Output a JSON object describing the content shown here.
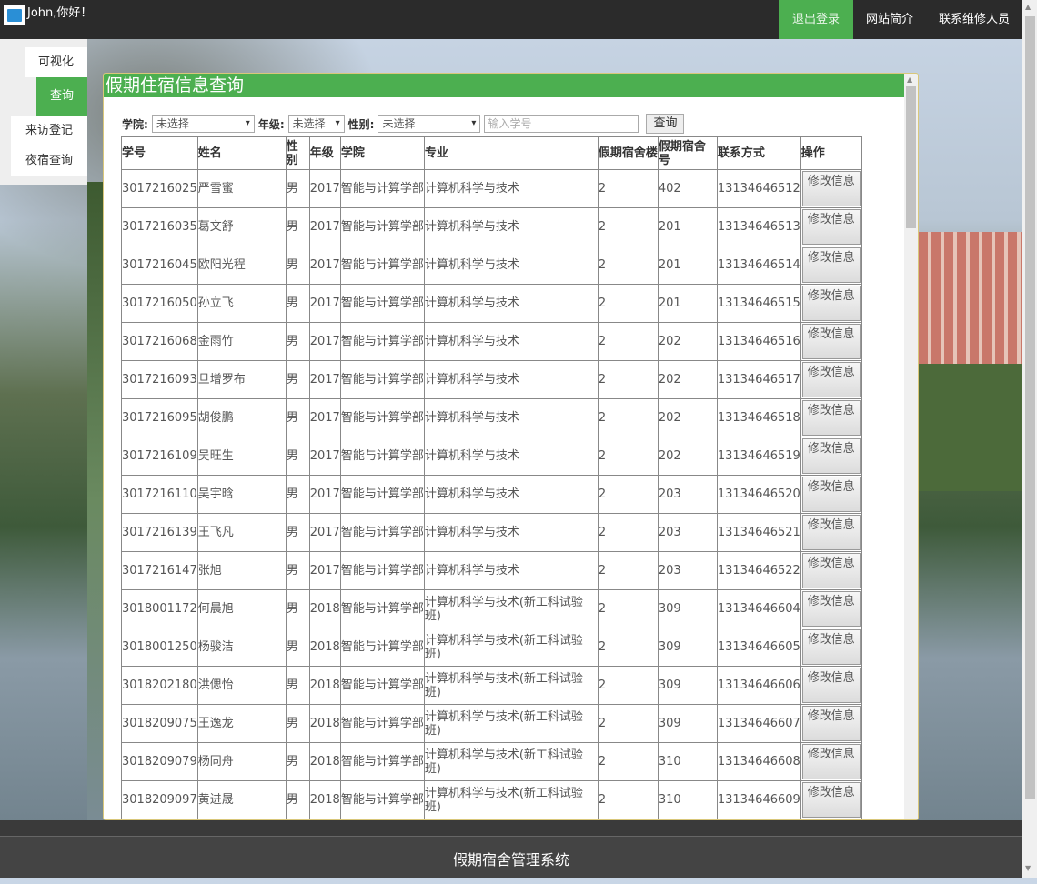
{
  "header": {
    "greeting": "John,你好！",
    "nav": [
      "退出登录",
      "网站简介",
      "联系维修人员"
    ]
  },
  "sidebar": {
    "items": [
      "可视化",
      "查询",
      "来访登记",
      "夜宿查询"
    ]
  },
  "panel": {
    "title": "假期住宿信息查询"
  },
  "filters": {
    "college_label": "学院:",
    "college_value": "未选择",
    "grade_label": "年级:",
    "grade_value": "未选择",
    "gender_label": "性别:",
    "gender_value": "未选择",
    "id_placeholder": "输入学号",
    "query_button": "查询"
  },
  "table": {
    "headers": [
      "学号",
      "姓名",
      "性别",
      "年级",
      "学院",
      "专业",
      "假期宿舍楼",
      "假期宿舍号",
      "联系方式",
      "操作"
    ],
    "edit_label": "修改信息",
    "rows": [
      [
        "3017216025",
        "严雪蜜",
        "男",
        "2017",
        "智能与计算学部",
        "计算机科学与技术",
        "2",
        "402",
        "13134646512"
      ],
      [
        "3017216035",
        "葛文舒",
        "男",
        "2017",
        "智能与计算学部",
        "计算机科学与技术",
        "2",
        "201",
        "13134646513"
      ],
      [
        "3017216045",
        "欧阳光程",
        "男",
        "2017",
        "智能与计算学部",
        "计算机科学与技术",
        "2",
        "201",
        "13134646514"
      ],
      [
        "3017216050",
        "孙立飞",
        "男",
        "2017",
        "智能与计算学部",
        "计算机科学与技术",
        "2",
        "201",
        "13134646515"
      ],
      [
        "3017216068",
        "金雨竹",
        "男",
        "2017",
        "智能与计算学部",
        "计算机科学与技术",
        "2",
        "202",
        "13134646516"
      ],
      [
        "3017216093",
        "旦增罗布",
        "男",
        "2017",
        "智能与计算学部",
        "计算机科学与技术",
        "2",
        "202",
        "13134646517"
      ],
      [
        "3017216095",
        "胡俊鹏",
        "男",
        "2017",
        "智能与计算学部",
        "计算机科学与技术",
        "2",
        "202",
        "13134646518"
      ],
      [
        "3017216109",
        "吴旺生",
        "男",
        "2017",
        "智能与计算学部",
        "计算机科学与技术",
        "2",
        "202",
        "13134646519"
      ],
      [
        "3017216110",
        "吴宇晗",
        "男",
        "2017",
        "智能与计算学部",
        "计算机科学与技术",
        "2",
        "203",
        "13134646520"
      ],
      [
        "3017216139",
        "王飞凡",
        "男",
        "2017",
        "智能与计算学部",
        "计算机科学与技术",
        "2",
        "203",
        "13134646521"
      ],
      [
        "3017216147",
        "张旭",
        "男",
        "2017",
        "智能与计算学部",
        "计算机科学与技术",
        "2",
        "203",
        "13134646522"
      ],
      [
        "3018001172",
        "何晨旭",
        "男",
        "2018",
        "智能与计算学部",
        "计算机科学与技术(新工科试验班)",
        "2",
        "309",
        "13134646604"
      ],
      [
        "3018001250",
        "杨骏洁",
        "男",
        "2018",
        "智能与计算学部",
        "计算机科学与技术(新工科试验班)",
        "2",
        "309",
        "13134646605"
      ],
      [
        "3018202180",
        "洪偲怡",
        "男",
        "2018",
        "智能与计算学部",
        "计算机科学与技术(新工科试验班)",
        "2",
        "309",
        "13134646606"
      ],
      [
        "3018209075",
        "王逸龙",
        "男",
        "2018",
        "智能与计算学部",
        "计算机科学与技术(新工科试验班)",
        "2",
        "309",
        "13134646607"
      ],
      [
        "3018209079",
        "杨同舟",
        "男",
        "2018",
        "智能与计算学部",
        "计算机科学与技术(新工科试验班)",
        "2",
        "310",
        "13134646608"
      ],
      [
        "3018209097",
        "黄进晟",
        "男",
        "2018",
        "智能与计算学部",
        "计算机科学与技术(新工科试验班)",
        "2",
        "310",
        "13134646609"
      ]
    ]
  },
  "footer": {
    "text": "假期宿舍管理系统"
  }
}
